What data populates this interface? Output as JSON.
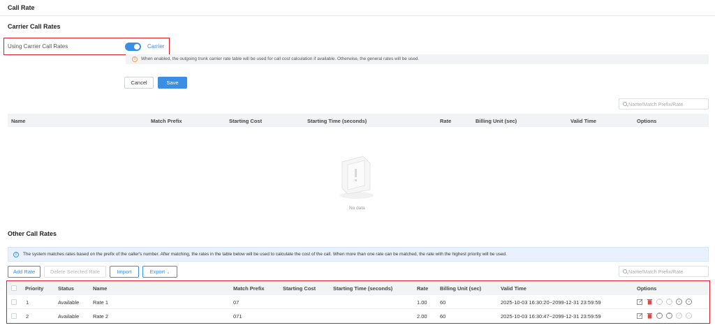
{
  "page": {
    "title": "Call Rate"
  },
  "carrier": {
    "section_title": "Carrier Call Rates",
    "toggle_label": "Using Carrier Call Rates",
    "toggle_value": "Carrier",
    "toggle_on": true,
    "hint": "When enabled, the outgoing trunk carrier rate table will be used for call cost calculation if available. Otherwise, the general rates will be used.",
    "cancel_label": "Cancel",
    "save_label": "Save",
    "search_placeholder": "Name/Match Prefix/Rate",
    "columns": [
      "Name",
      "Match Prefix",
      "Starting Cost",
      "Starting Time (seconds)",
      "Rate",
      "Billing Unit (sec)",
      "Valid Time",
      "Options"
    ],
    "empty_text": "No data"
  },
  "other": {
    "section_title": "Other Call Rates",
    "info": "The system matches rates based on the prefix of the caller's number. After matching, the rates in the table below will be used to calculate the cost of the call. When more than one rate can be matched, the rate with the highest priority will be used.",
    "add_label": "Add Rate",
    "delete_label": "Delete Selected Rate",
    "import_label": "Import",
    "export_label": "Export",
    "search_placeholder": "Name/Match Prefix/Rate",
    "columns": [
      "Priority",
      "Status",
      "Name",
      "Match Prefix",
      "Starting Cost",
      "Starting Time (seconds)",
      "Rate",
      "Billing Unit (sec)",
      "Valid Time",
      "Options"
    ],
    "rows": [
      {
        "priority": "1",
        "status": "Available",
        "name": "Rate 1",
        "prefix": "07",
        "starting_cost": "",
        "starting_time": "",
        "rate": "1.00",
        "billing_unit": "60",
        "valid_time": "2025-10-03 16:30:20~2099-12-31 23:59:59"
      },
      {
        "priority": "2",
        "status": "Available",
        "name": "Rate 2",
        "prefix": "071",
        "starting_cost": "",
        "starting_time": "",
        "rate": "2.00",
        "billing_unit": "60",
        "valid_time": "2025-10-03 16:30:47~2099-12-31 23:59:59"
      }
    ]
  },
  "colors": {
    "accent": "#3a8ee6",
    "highlight_border": "#d81e2a",
    "delete_icon": "#e04848"
  }
}
